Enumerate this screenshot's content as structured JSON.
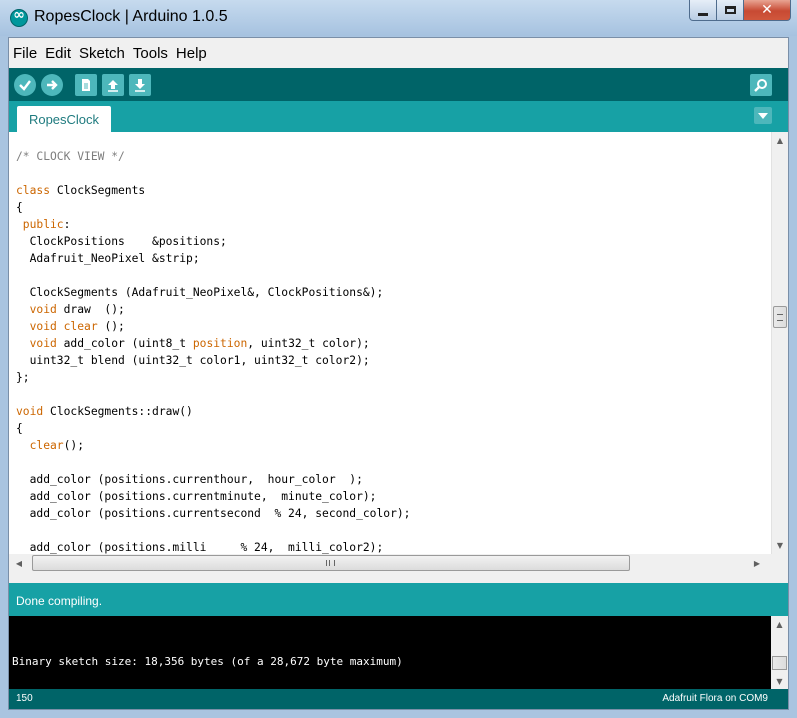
{
  "window": {
    "title": "RopesClock | Arduino 1.0.5",
    "close_glyph": "✕"
  },
  "menu": [
    "File",
    "Edit",
    "Sketch",
    "Tools",
    "Help"
  ],
  "toolbar": {
    "buttons": [
      "verify-icon",
      "upload-icon",
      "new-icon",
      "open-icon",
      "save-icon"
    ],
    "serial_monitor_icon": "magnifier-icon"
  },
  "tabs": [
    {
      "label": "RopesClock"
    }
  ],
  "code_lines": [
    [
      [
        "cm",
        "/* CLOCK VIEW */"
      ]
    ],
    [],
    [
      [
        "kw",
        "class"
      ],
      [
        "t",
        " ClockSegments"
      ]
    ],
    [
      [
        "t",
        "{"
      ]
    ],
    [
      [
        "kw",
        " public"
      ],
      [
        "t",
        ":"
      ]
    ],
    [
      [
        "t",
        "  ClockPositions    &positions;"
      ]
    ],
    [
      [
        "t",
        "  Adafruit_NeoPixel &strip;"
      ]
    ],
    [],
    [
      [
        "t",
        "  ClockSegments (Adafruit_NeoPixel&, ClockPositions&);"
      ]
    ],
    [
      [
        "kw",
        "  void"
      ],
      [
        "t",
        " draw  ();"
      ]
    ],
    [
      [
        "kw",
        "  void"
      ],
      [
        "t",
        " "
      ],
      [
        "kw",
        "clear"
      ],
      [
        "t",
        " ();"
      ]
    ],
    [
      [
        "kw",
        "  void"
      ],
      [
        "t",
        " add_color (uint8_t "
      ],
      [
        "kw",
        "position"
      ],
      [
        "t",
        ", uint32_t color);"
      ]
    ],
    [
      [
        "t",
        "  uint32_t blend (uint32_t color1, uint32_t color2);"
      ]
    ],
    [
      [
        "t",
        "};"
      ]
    ],
    [],
    [
      [
        "kw",
        "void"
      ],
      [
        "t",
        " ClockSegments::draw()"
      ]
    ],
    [
      [
        "t",
        "{"
      ]
    ],
    [
      [
        "kw",
        "  clear"
      ],
      [
        "t",
        "();"
      ]
    ],
    [],
    [
      [
        "t",
        "  add_color (positions.currenthour,  hour_color  );"
      ]
    ],
    [
      [
        "t",
        "  add_color (positions.currentminute,  minute_color);"
      ]
    ],
    [
      [
        "t",
        "  add_color (positions.currentsecond  % 24, second_color);"
      ]
    ],
    [],
    [
      [
        "t",
        "  add_color (positions.milli     % 24,  milli_color2);"
      ]
    ]
  ],
  "status": {
    "message": "Done compiling.",
    "console": "Binary sketch size: 18,356 bytes (of a 28,672 byte maximum)",
    "line_number": "150",
    "board": "Adafruit Flora on COM9"
  },
  "colors": {
    "toolbar": "#006468",
    "tabbar": "#17a1a5",
    "keyword": "#cc6600",
    "comment": "#7e7e7e"
  }
}
